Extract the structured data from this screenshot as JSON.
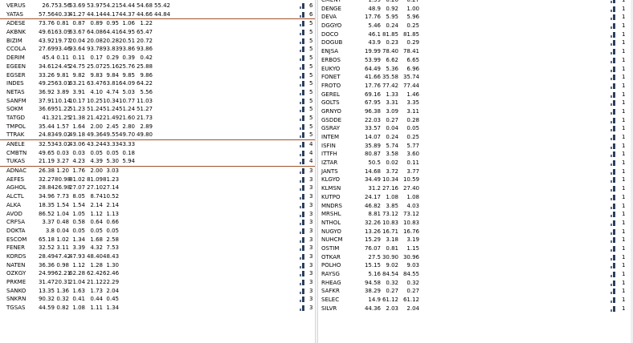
{
  "left_rows": [
    {
      "sym": "VERUS",
      "v": [
        "26.7",
        "53.56",
        "53.69",
        "53.97",
        "54.21",
        "54.44",
        "54.68",
        "55.42",
        ""
      ],
      "count": "6"
    },
    {
      "sym": "YATAS",
      "v": [
        "57.56",
        "40.33",
        "41.27",
        "44.14",
        "44.17",
        "44.37",
        "44.66",
        "44.84",
        ""
      ],
      "count": "6",
      "sep": true
    },
    {
      "sym": "ADESE",
      "v": [
        "73.76",
        "0.81",
        "0.87",
        "0.89",
        "0.95",
        "1.06",
        "1.22",
        "",
        ""
      ],
      "count": "5"
    },
    {
      "sym": "AKBNK",
      "v": [
        "49.61",
        "63.09",
        "63.67",
        "64.08",
        "64.41",
        "64.95",
        "65.47",
        "",
        ""
      ],
      "count": "5"
    },
    {
      "sym": "BIZIM",
      "v": [
        "43.92",
        "19.77",
        "20.04",
        "20.08",
        "20.28",
        "20.51",
        "20.72",
        "",
        ""
      ],
      "count": "5"
    },
    {
      "sym": "CCOLA",
      "v": [
        "27.69",
        "93.46",
        "93.64",
        "93.78",
        "93.83",
        "93.86",
        "93.86",
        "",
        ""
      ],
      "count": "5"
    },
    {
      "sym": "DERIM",
      "v": [
        "45.4",
        "0.11",
        "0.11",
        "0.17",
        "0.29",
        "0.39",
        "0.42",
        "",
        ""
      ],
      "count": "5"
    },
    {
      "sym": "EGEEN",
      "v": [
        "34.61",
        "24.45",
        "24.75",
        "25.07",
        "25.16",
        "25.76",
        "25.88",
        "",
        ""
      ],
      "count": "5"
    },
    {
      "sym": "EGSER",
      "v": [
        "33.26",
        "9.81",
        "9.82",
        "9.83",
        "9.84",
        "9.85",
        "9.86",
        "",
        ""
      ],
      "count": "5"
    },
    {
      "sym": "INDES",
      "v": [
        "49.25",
        "63.01",
        "63.21",
        "63.47",
        "63.81",
        "64.09",
        "64.22",
        "",
        ""
      ],
      "count": "5"
    },
    {
      "sym": "NETAS",
      "v": [
        "36.92",
        "3.89",
        "3.91",
        "4.10",
        "4.74",
        "5.03",
        "5.56",
        "",
        ""
      ],
      "count": "5"
    },
    {
      "sym": "SANFM",
      "v": [
        "37.91",
        "10.14",
        "10.17",
        "10.25",
        "10.34",
        "10.77",
        "11.03",
        "",
        ""
      ],
      "count": "5"
    },
    {
      "sym": "SOKM",
      "v": [
        "36.69",
        "51.22",
        "51.23",
        "51.24",
        "51.24",
        "51.24",
        "51.27",
        "",
        ""
      ],
      "count": "5"
    },
    {
      "sym": "TATGD",
      "v": [
        "41.3",
        "21.25",
        "21.38",
        "21.42",
        "21.49",
        "21.60",
        "21.73",
        "",
        ""
      ],
      "count": "5"
    },
    {
      "sym": "TMPOL",
      "v": [
        "35.44",
        "1.57",
        "1.64",
        "2.00",
        "2.45",
        "2.80",
        "2.89",
        "",
        ""
      ],
      "count": "5"
    },
    {
      "sym": "TTRAK",
      "v": [
        "24.83",
        "49.02",
        "49.18",
        "49.36",
        "49.55",
        "49.70",
        "49.80",
        "",
        ""
      ],
      "count": "5",
      "sep": true
    },
    {
      "sym": "ANELE",
      "v": [
        "32.53",
        "43.02",
        "43.06",
        "43.24",
        "43.33",
        "43.33",
        "",
        "",
        ""
      ],
      "count": "4"
    },
    {
      "sym": "CMBTN",
      "v": [
        "49.65",
        "0.03",
        "0.03",
        "0.05",
        "0.05",
        "0.18",
        "",
        "",
        ""
      ],
      "count": "4"
    },
    {
      "sym": "TUKAS",
      "v": [
        "21.19",
        "3.27",
        "4.23",
        "4.39",
        "5.30",
        "5.94",
        "",
        "",
        ""
      ],
      "count": "4",
      "sep": true
    },
    {
      "sym": "ADNAC",
      "v": [
        "26.38",
        "1.20",
        "1.76",
        "2.00",
        "3.03",
        "",
        "",
        "",
        ""
      ],
      "count": "3"
    },
    {
      "sym": "AEFES",
      "v": [
        "32.27",
        "80.98",
        "81.02",
        "81.09",
        "81.23",
        "",
        "",
        "",
        ""
      ],
      "count": "3"
    },
    {
      "sym": "AGHOL",
      "v": [
        "28.84",
        "26.98",
        "27.07",
        "27.10",
        "27.14",
        "",
        "",
        "",
        ""
      ],
      "count": "3"
    },
    {
      "sym": "ALCTL",
      "v": [
        "34.96",
        "7.73",
        "8.05",
        "8.74",
        "10.52",
        "",
        "",
        "",
        ""
      ],
      "count": "3"
    },
    {
      "sym": "ALKA",
      "v": [
        "18.35",
        "1.54",
        "1.54",
        "2.14",
        "2.14",
        "",
        "",
        "",
        ""
      ],
      "count": "3"
    },
    {
      "sym": "AVOD",
      "v": [
        "86.52",
        "1.04",
        "1.05",
        "1.12",
        "1.13",
        "",
        "",
        "",
        ""
      ],
      "count": "3"
    },
    {
      "sym": "CRFSA",
      "v": [
        "3.37",
        "0.48",
        "0.58",
        "0.64",
        "0.66",
        "",
        "",
        "",
        ""
      ],
      "count": "3"
    },
    {
      "sym": "DOKTA",
      "v": [
        "3.8",
        "0.04",
        "0.05",
        "0.05",
        "0.05",
        "",
        "",
        "",
        ""
      ],
      "count": "3"
    },
    {
      "sym": "ESCOM",
      "v": [
        "65.18",
        "1.02",
        "1.34",
        "1.68",
        "2.58",
        "",
        "",
        "",
        ""
      ],
      "count": "3"
    },
    {
      "sym": "FENER",
      "v": [
        "32.52",
        "3.11",
        "3.39",
        "4.32",
        "7.53",
        "",
        "",
        "",
        ""
      ],
      "count": "3"
    },
    {
      "sym": "KORDS",
      "v": [
        "28.49",
        "47.42",
        "47.93",
        "48.40",
        "48.43",
        "",
        "",
        "",
        ""
      ],
      "count": "3"
    },
    {
      "sym": "NATEN",
      "v": [
        "36.36",
        "0.98",
        "1.12",
        "1.28",
        "1.30",
        "",
        "",
        "",
        ""
      ],
      "count": "3"
    },
    {
      "sym": "OZKGY",
      "v": [
        "24.99",
        "62.21",
        "62.28",
        "62.42",
        "62.46",
        "",
        "",
        "",
        ""
      ],
      "count": "3"
    },
    {
      "sym": "PRKME",
      "v": [
        "31.47",
        "20.31",
        "21.04",
        "21.12",
        "22.29",
        "",
        "",
        "",
        ""
      ],
      "count": "3"
    },
    {
      "sym": "SANKO",
      "v": [
        "13.35",
        "1.36",
        "1.63",
        "1.73",
        "2.04",
        "",
        "",
        "",
        ""
      ],
      "count": "3"
    },
    {
      "sym": "SNKRN",
      "v": [
        "90.32",
        "0.32",
        "0.41",
        "0.44",
        "0.45",
        "",
        "",
        "",
        ""
      ],
      "count": "3"
    },
    {
      "sym": "TGSAS",
      "v": [
        "44.59",
        "0.82",
        "1.08",
        "1.11",
        "1.34",
        "",
        "",
        "",
        ""
      ],
      "count": "3"
    }
  ],
  "right_rows": [
    {
      "sym": "CMENT",
      "v": [
        "1.59",
        "0.26",
        "0.27"
      ],
      "count": "1"
    },
    {
      "sym": "DENGE",
      "v": [
        "48.9",
        "0.92",
        "1.00"
      ],
      "count": "1"
    },
    {
      "sym": "DEVA",
      "v": [
        "17.76",
        "5.95",
        "5.96"
      ],
      "count": "1"
    },
    {
      "sym": "DGGYO",
      "v": [
        "5.46",
        "0.24",
        "0.25"
      ],
      "count": "1"
    },
    {
      "sym": "DOCO",
      "v": [
        "46.1",
        "81.85",
        "81.85"
      ],
      "count": "1"
    },
    {
      "sym": "DOGUB",
      "v": [
        "43.9",
        "0.23",
        "0.29"
      ],
      "count": "1"
    },
    {
      "sym": "ENJSA",
      "v": [
        "19.99",
        "78.40",
        "78.41"
      ],
      "count": "1"
    },
    {
      "sym": "ERBOS",
      "v": [
        "53.99",
        "6.62",
        "6.65"
      ],
      "count": "1"
    },
    {
      "sym": "EUKYO",
      "v": [
        "64.49",
        "5.36",
        "6.96"
      ],
      "count": "1"
    },
    {
      "sym": "FONET",
      "v": [
        "41.66",
        "35.58",
        "35.74"
      ],
      "count": "1"
    },
    {
      "sym": "FROTO",
      "v": [
        "17.76",
        "77.42",
        "77.44"
      ],
      "count": "1"
    },
    {
      "sym": "GEREL",
      "v": [
        "69.16",
        "1.33",
        "1.46"
      ],
      "count": "1"
    },
    {
      "sym": "GOLTS",
      "v": [
        "67.95",
        "3.31",
        "3.35"
      ],
      "count": "1"
    },
    {
      "sym": "GRNYO",
      "v": [
        "96.38",
        "3.09",
        "3.11"
      ],
      "count": "1"
    },
    {
      "sym": "GSDDE",
      "v": [
        "22.03",
        "0.27",
        "0.28"
      ],
      "count": "1"
    },
    {
      "sym": "GSRAY",
      "v": [
        "33.57",
        "0.04",
        "0.05"
      ],
      "count": "1"
    },
    {
      "sym": "INTEM",
      "v": [
        "14.07",
        "0.24",
        "0.25"
      ],
      "count": "1"
    },
    {
      "sym": "ISFIN",
      "v": [
        "35.89",
        "5.74",
        "5.77"
      ],
      "count": "1"
    },
    {
      "sym": "ITTFH",
      "v": [
        "80.87",
        "3.58",
        "3.60"
      ],
      "count": "1"
    },
    {
      "sym": "IZTAR",
      "v": [
        "50.5",
        "0.02",
        "0.11"
      ],
      "count": "1"
    },
    {
      "sym": "JANTS",
      "v": [
        "14.68",
        "3.72",
        "3.77"
      ],
      "count": "1"
    },
    {
      "sym": "KLGYO",
      "v": [
        "34.49",
        "10.34",
        "10.59"
      ],
      "count": "1"
    },
    {
      "sym": "KLMSN",
      "v": [
        "31.2",
        "27.16",
        "27.40"
      ],
      "count": "1"
    },
    {
      "sym": "KUTPO",
      "v": [
        "24.17",
        "1.08",
        "1.08"
      ],
      "count": "1"
    },
    {
      "sym": "MNDRS",
      "v": [
        "46.82",
        "3.85",
        "4.03"
      ],
      "count": "1"
    },
    {
      "sym": "MRSHL",
      "v": [
        "8.81",
        "73.12",
        "73.12"
      ],
      "count": "1"
    },
    {
      "sym": "NTHOL",
      "v": [
        "32.26",
        "10.83",
        "10.83"
      ],
      "count": "1"
    },
    {
      "sym": "NUGYO",
      "v": [
        "13.26",
        "16.71",
        "16.76"
      ],
      "count": "1"
    },
    {
      "sym": "NUHCM",
      "v": [
        "15.29",
        "3.18",
        "3.19"
      ],
      "count": "1"
    },
    {
      "sym": "OSTIM",
      "v": [
        "76.07",
        "0.81",
        "1.15"
      ],
      "count": "1"
    },
    {
      "sym": "OTKAR",
      "v": [
        "27.5",
        "30.90",
        "30.96"
      ],
      "count": "1"
    },
    {
      "sym": "POLHO",
      "v": [
        "15.15",
        "9.02",
        "9.03"
      ],
      "count": "1"
    },
    {
      "sym": "RAYSG",
      "v": [
        "5.16",
        "84.54",
        "84.55"
      ],
      "count": "1"
    },
    {
      "sym": "RHEAG",
      "v": [
        "94.58",
        "0.32",
        "0.32"
      ],
      "count": "1"
    },
    {
      "sym": "SAFKR",
      "v": [
        "38.29",
        "0.27",
        "0.27"
      ],
      "count": "1"
    },
    {
      "sym": "SELEC",
      "v": [
        "14.9",
        "61.12",
        "61.12"
      ],
      "count": "1"
    },
    {
      "sym": "SILVR",
      "v": [
        "44.36",
        "2.03",
        "2.04"
      ],
      "count": "1"
    }
  ]
}
